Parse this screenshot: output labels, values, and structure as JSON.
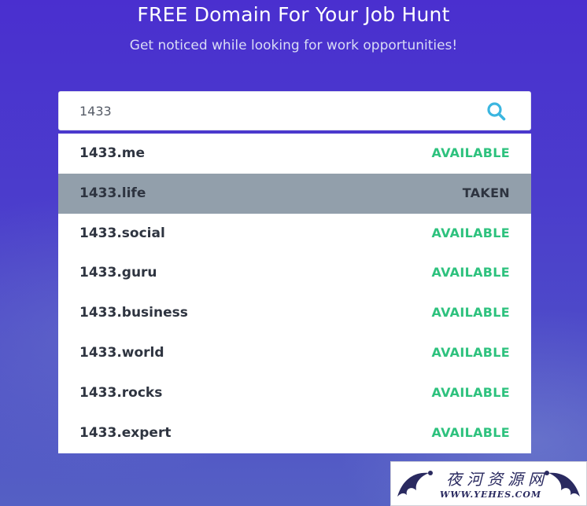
{
  "hero": {
    "title": "FREE Domain For Your Job Hunt",
    "subtitle": "Get noticed while looking for work opportunities!"
  },
  "search": {
    "value": "1433",
    "icon": "search-icon"
  },
  "colors": {
    "available": "#2ec27e",
    "taken_row": "#929fab",
    "search_icon": "#3bb6e0"
  },
  "results": [
    {
      "domain": "1433.me",
      "status": "AVAILABLE"
    },
    {
      "domain": "1433.life",
      "status": "TAKEN"
    },
    {
      "domain": "1433.social",
      "status": "AVAILABLE"
    },
    {
      "domain": "1433.guru",
      "status": "AVAILABLE"
    },
    {
      "domain": "1433.business",
      "status": "AVAILABLE"
    },
    {
      "domain": "1433.world",
      "status": "AVAILABLE"
    },
    {
      "domain": "1433.rocks",
      "status": "AVAILABLE"
    },
    {
      "domain": "1433.expert",
      "status": "AVAILABLE"
    }
  ],
  "watermark": {
    "chinese": "夜河资源网",
    "url": "WWW.YEHES.COM"
  }
}
